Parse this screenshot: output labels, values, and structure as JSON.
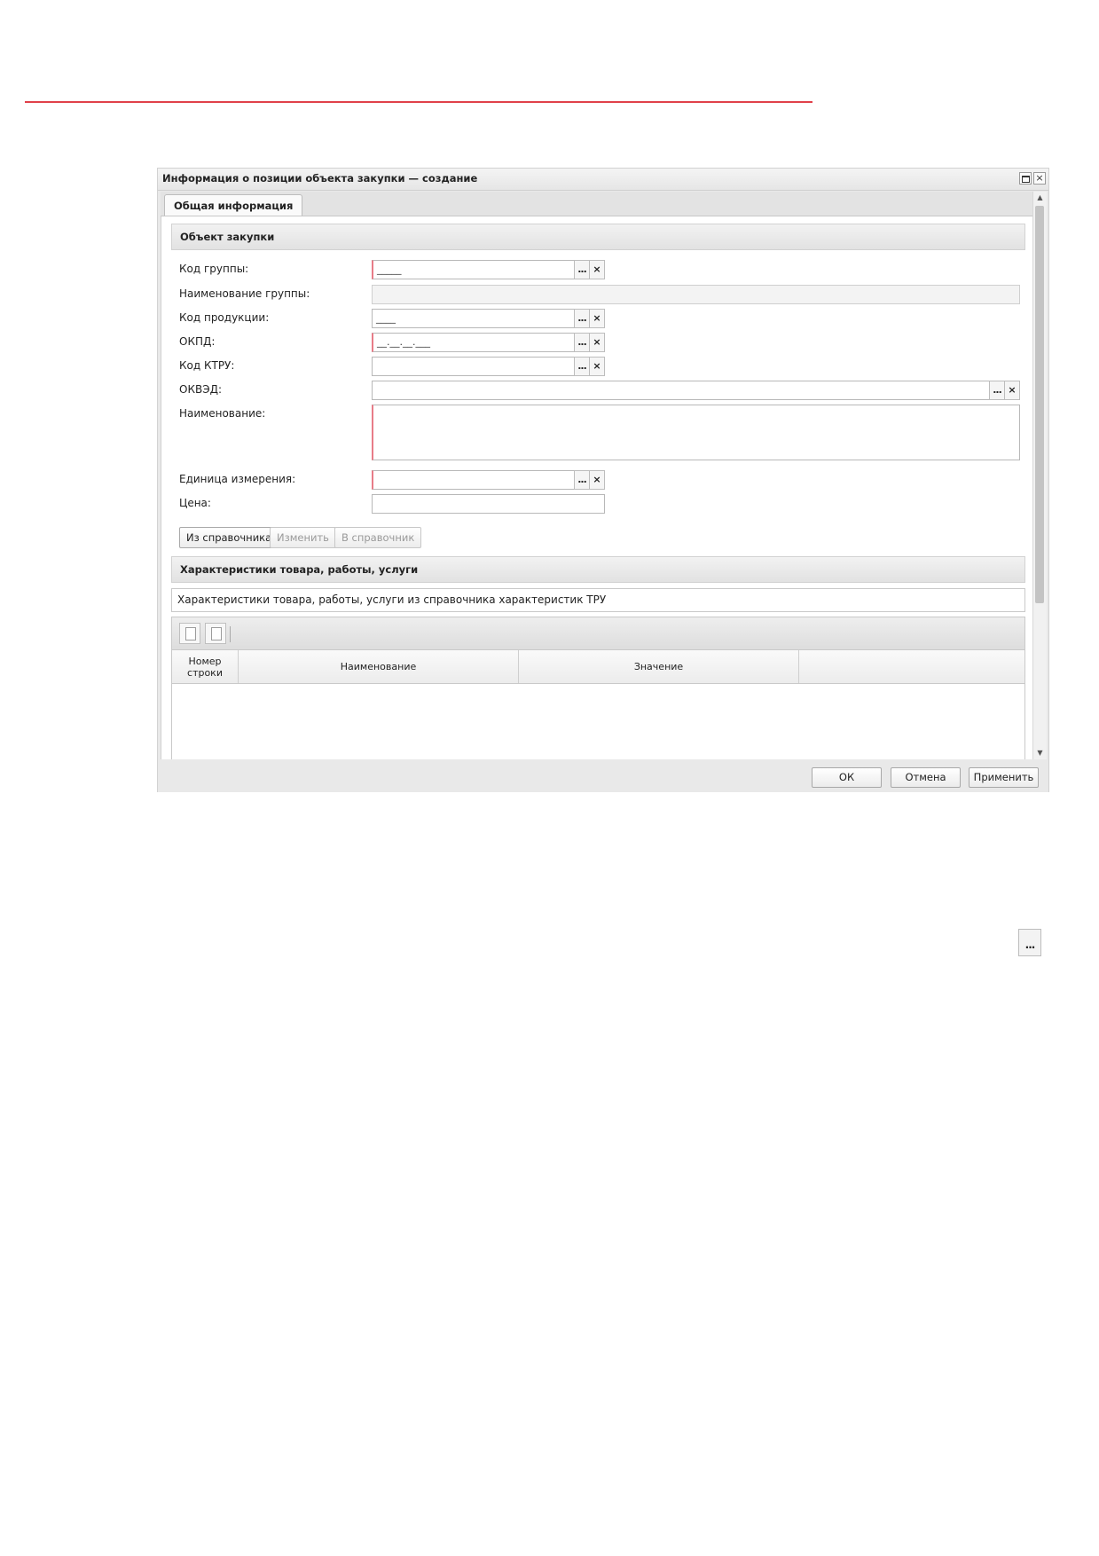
{
  "window": {
    "title": "Информация о позиции объекта закупки — создание"
  },
  "tabs": [
    {
      "label": "Общая информация",
      "active": true
    }
  ],
  "section_object": {
    "title": "Объект закупки"
  },
  "form": {
    "group_code": {
      "label": "Код группы:",
      "value": "_____"
    },
    "group_name": {
      "label": "Наименование группы:",
      "value": ""
    },
    "product_code": {
      "label": "Код продукции:",
      "value": "____"
    },
    "okpd": {
      "label": "ОКПД:",
      "value": "__.__.__.___"
    },
    "ktru_code": {
      "label": "Код КТРУ:",
      "value": ""
    },
    "okved": {
      "label": "ОКВЭД:",
      "value": ""
    },
    "name": {
      "label": "Наименование:",
      "value": ""
    },
    "unit": {
      "label": "Единица измерения:",
      "value": ""
    },
    "price": {
      "label": "Цена:",
      "value": ""
    }
  },
  "buttons": {
    "from_catalog": "Из справочника",
    "edit": "Изменить",
    "to_catalog": "В справочник"
  },
  "section_characteristics": {
    "title": "Характеристики товара, работы, услуги",
    "note": "Характеристики товара, работы, услуги из справочника характеристик ТРУ"
  },
  "grid": {
    "columns": [
      "Номер строки",
      "Наименование",
      "Значение",
      ""
    ],
    "rows": []
  },
  "footer": {
    "ok": "ОК",
    "cancel": "Отмена",
    "apply": "Применить"
  },
  "icons": {
    "ellipsis": "...",
    "clear": "×",
    "scroll_up": "▲",
    "scroll_down": "▼"
  },
  "colors": {
    "page_rule": "#e0404a",
    "required_marker": "#e87c88"
  }
}
